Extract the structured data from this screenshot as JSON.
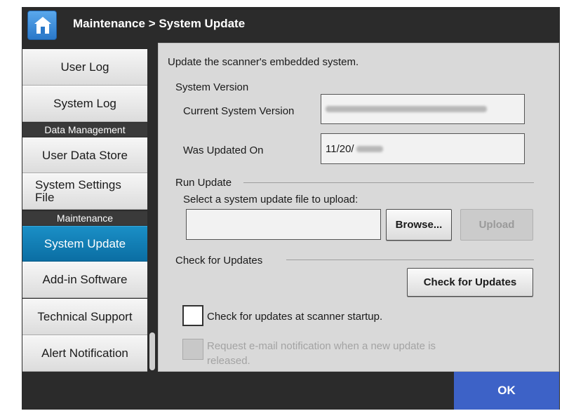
{
  "header": {
    "title": "Maintenance > System Update",
    "home_icon": "home-icon"
  },
  "sidebar": {
    "items": [
      {
        "label": "User Log"
      },
      {
        "label": "System Log"
      },
      {
        "section": "Data Management"
      },
      {
        "label": "User Data Store"
      },
      {
        "label": "System Settings File"
      },
      {
        "section": "Maintenance"
      },
      {
        "label": "System Update",
        "active": true
      },
      {
        "label": "Add-in Software"
      },
      {
        "label": "Technical Support"
      },
      {
        "label": "Alert Notification"
      }
    ]
  },
  "main": {
    "description": "Update the scanner's embedded system.",
    "system_version": {
      "heading": "System Version",
      "current_label": "Current System Version",
      "current_value": "",
      "updated_label": "Was Updated On",
      "updated_value": "11/20/"
    },
    "run_update": {
      "heading": "Run Update",
      "prompt": "Select a system update file to upload:",
      "file_value": "",
      "browse_label": "Browse...",
      "upload_label": "Upload"
    },
    "check_updates": {
      "heading": "Check for Updates",
      "button_label": "Check for Updates",
      "startup_label": "Check for updates at scanner startup.",
      "startup_checked": false,
      "email_label_line1": "Request e-mail notification when a new update is",
      "email_label_line2": "released.",
      "email_checked": false
    }
  },
  "footer": {
    "ok_label": "OK"
  },
  "colors": {
    "accent_active": "#0b7db5",
    "ok_button": "#3d62c7",
    "chrome": "#2b2b2b",
    "panel": "#d9d9d9"
  }
}
